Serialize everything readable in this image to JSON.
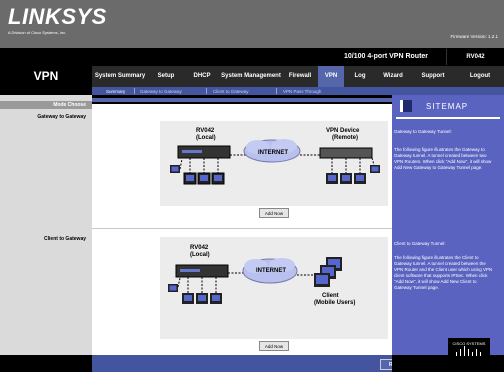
{
  "header": {
    "logo_text": "LINKSYS",
    "logo_sub": "A Division of Cisco Systems, Inc.",
    "firmware": "Firmware Version: 1.2.1"
  },
  "nav": {
    "section_title": "VPN",
    "router_name": "10/100 4-port VPN Router",
    "model": "RV042",
    "tabs": [
      {
        "label": "System Summary"
      },
      {
        "label": "Setup"
      },
      {
        "label": "DHCP"
      },
      {
        "label": "System Management"
      },
      {
        "label": "Firewall"
      },
      {
        "label": "VPN"
      },
      {
        "label": "Log"
      },
      {
        "label": "Wizard"
      },
      {
        "label": "Support"
      },
      {
        "label": "Logout"
      }
    ],
    "subtabs": [
      {
        "label": "Summary"
      },
      {
        "label": "Gateway to Gateway"
      },
      {
        "label": "Client to Gateway"
      },
      {
        "label": "VPN Pass Through"
      }
    ]
  },
  "left": {
    "mode_choose": "Mode Choose",
    "gateway_label": "Gateway to Gateway",
    "client_label": "Client to Gateway"
  },
  "diagram1": {
    "router_label1": "RV042",
    "router_label2": "(Local)",
    "internet": "INTERNET",
    "device_label1": "VPN Device",
    "device_label2": "(Remote)"
  },
  "diagram2": {
    "router_label1": "RV042",
    "router_label2": "(Local)",
    "internet": "INTERNET",
    "client_label1": "Client",
    "client_label2": "(Mobile Users)"
  },
  "buttons": {
    "add_now": "Add Now",
    "return": "Return"
  },
  "sitemap": {
    "title": "SITEMAP",
    "g2g_title": "Gateway to Gateway Tunnel:",
    "g2g_text": "The following figure illustrates the Gateway to Gateway tunnel. A tunnel created between two VPN Routers. When click \"Add Now\", it will show Add New Gateway to Gateway Tunnel page.",
    "c2g_title": "Client to Gateway Tunnel:",
    "c2g_text": "The following figure illustrates the Client to Gateway tunnel. A tunnel created between the VPN Router and the Client user which using VPN client software that supports IPSec. When click \"Add Now\", it will show Add New Client to Gateway Tunnel page."
  },
  "footer": {
    "brand": "CISCO SYSTEMS"
  }
}
